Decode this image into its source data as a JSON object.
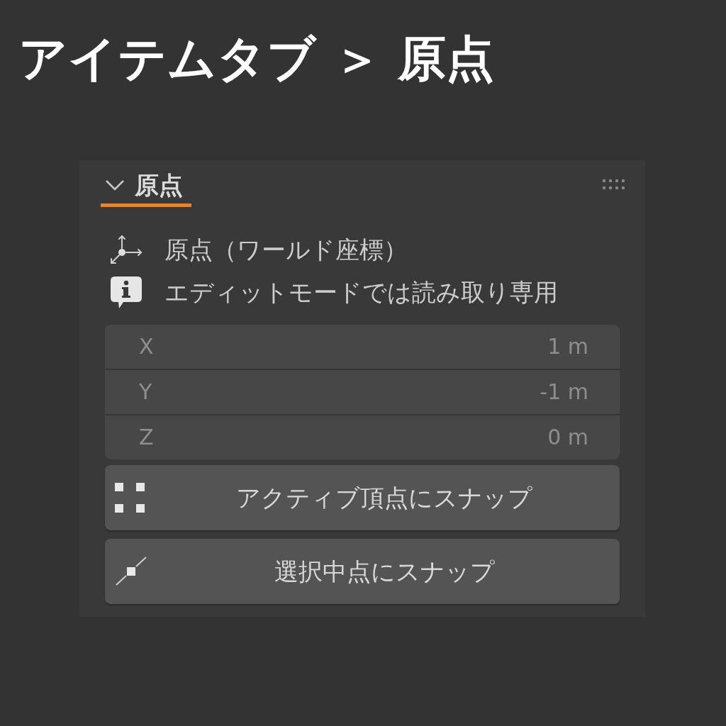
{
  "heading": "アイテムタブ ＞ 原点",
  "panel": {
    "title": "原点",
    "expanded": true,
    "info_lines": [
      {
        "kind": "origin",
        "text": "原点（ワールド座標）"
      },
      {
        "kind": "info",
        "text": "エディットモードでは読み取り専用"
      }
    ],
    "fields": [
      {
        "label": "X",
        "value": "1 m",
        "disabled": true
      },
      {
        "label": "Y",
        "value": "-1 m",
        "disabled": true
      },
      {
        "label": "Z",
        "value": "0 m",
        "disabled": true
      }
    ],
    "buttons": [
      {
        "kind": "active_vertex",
        "label": "アクティブ頂点にスナップ"
      },
      {
        "kind": "midpoint",
        "label": "選択中点にスナップ"
      }
    ]
  }
}
